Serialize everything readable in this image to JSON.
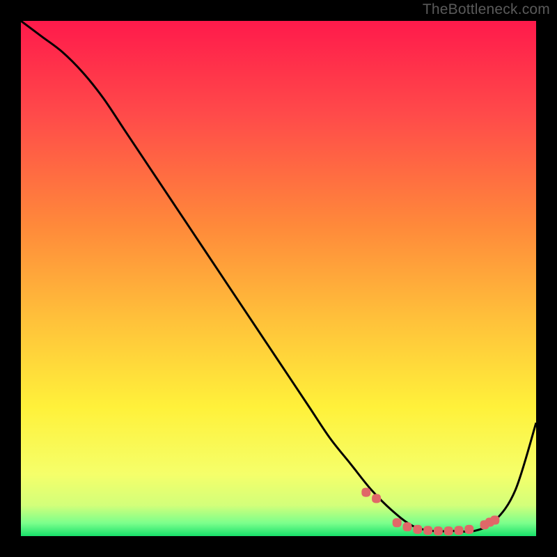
{
  "watermark": "TheBottleneck.com",
  "chart_data": {
    "type": "line",
    "title": "",
    "xlabel": "",
    "ylabel": "",
    "xlim": [
      0,
      100
    ],
    "ylim": [
      0,
      100
    ],
    "series": [
      {
        "name": "curve",
        "x": [
          0,
          4,
          8,
          12,
          16,
          20,
          24,
          28,
          32,
          36,
          40,
          44,
          48,
          52,
          56,
          60,
          64,
          68,
          72,
          76,
          80,
          84,
          88,
          92,
          96,
          100
        ],
        "values": [
          100,
          97,
          94,
          90,
          85,
          79,
          73,
          67,
          61,
          55,
          49,
          43,
          37,
          31,
          25,
          19,
          14,
          9,
          5,
          2,
          1,
          1,
          1,
          3,
          9,
          22
        ]
      }
    ],
    "markers": {
      "name": "highlight-dots",
      "x": [
        67,
        69,
        73,
        75,
        77,
        79,
        81,
        83,
        85,
        87,
        90,
        91,
        92
      ],
      "values": [
        8.5,
        7.3,
        2.6,
        1.8,
        1.3,
        1.1,
        1.0,
        1.0,
        1.1,
        1.3,
        2.2,
        2.7,
        3.1
      ]
    },
    "gradient_stops": [
      {
        "offset": 0.0,
        "color": "#ff1a4b"
      },
      {
        "offset": 0.18,
        "color": "#ff4a4a"
      },
      {
        "offset": 0.4,
        "color": "#ff8a3a"
      },
      {
        "offset": 0.58,
        "color": "#ffc13a"
      },
      {
        "offset": 0.75,
        "color": "#fff13a"
      },
      {
        "offset": 0.88,
        "color": "#f5ff6a"
      },
      {
        "offset": 0.94,
        "color": "#d3ff7a"
      },
      {
        "offset": 0.975,
        "color": "#7bff8c"
      },
      {
        "offset": 1.0,
        "color": "#18e06a"
      }
    ],
    "marker_color": "#e06868",
    "curve_color": "#000000"
  }
}
